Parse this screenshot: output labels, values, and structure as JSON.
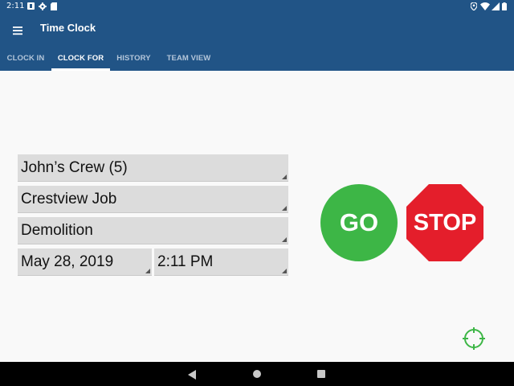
{
  "status_bar": {
    "time": "2:11",
    "left_icons": [
      "notification-icon",
      "settings-icon",
      "sd-card-icon"
    ],
    "right_icons": [
      "location-icon",
      "wifi-icon",
      "signal-icon",
      "battery-icon"
    ]
  },
  "app_bar": {
    "title": "Time Clock",
    "menu_icon": "hamburger-menu-icon"
  },
  "tabs": [
    {
      "label": "CLOCK IN",
      "active": false
    },
    {
      "label": "CLOCK FOR",
      "active": true
    },
    {
      "label": "HISTORY",
      "active": false
    },
    {
      "label": "TEAM VIEW",
      "active": false
    }
  ],
  "form": {
    "crew": "John’s Crew (5)",
    "job": "Crestview Job",
    "task": "Demolition",
    "date": "May 28, 2019",
    "time": "2:11 PM"
  },
  "actions": {
    "go_label": "GO",
    "stop_label": "STOP"
  },
  "colors": {
    "app_bar": "#215486",
    "go": "#3db646",
    "stop": "#e41e2b",
    "target_icon": "#3db646",
    "field_bg": "#dcdcdc"
  },
  "nav_bar": {
    "icons": [
      "back-icon",
      "home-icon",
      "recents-icon"
    ]
  }
}
